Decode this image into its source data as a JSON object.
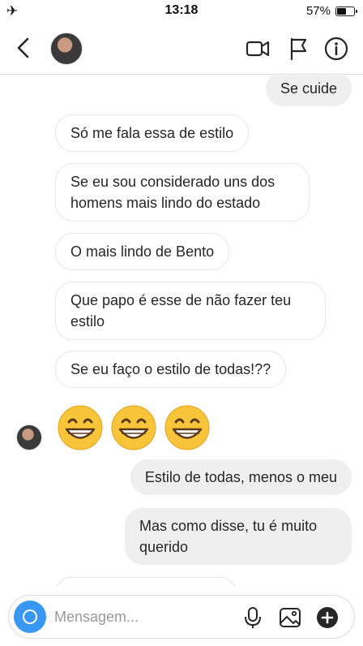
{
  "status_bar": {
    "time": "13:18",
    "battery": "57%",
    "battery_level": 0.57
  },
  "header": {
    "contact_name": ""
  },
  "messages": [
    {
      "dir": "out",
      "text": "Se cuide"
    },
    {
      "dir": "in",
      "text": "Só me fala essa de estilo"
    },
    {
      "dir": "in",
      "text": "Se eu sou considerado uns dos homens mais lindo do estado"
    },
    {
      "dir": "in",
      "text": "O mais lindo de Bento"
    },
    {
      "dir": "in",
      "text": "Que papo é esse de não fazer teu estilo"
    },
    {
      "dir": "in",
      "text": "Se eu faço o estilo de todas!??"
    },
    {
      "dir": "in",
      "text": "😁😁😁",
      "kind": "emoji"
    },
    {
      "dir": "out",
      "text": "Estilo de todas, menos o meu"
    },
    {
      "dir": "out",
      "text": "Mas como disse, tu é muito querido"
    }
  ],
  "composer": {
    "placeholder": "Mensagem..."
  },
  "icons": {
    "back": "chevron-left-icon",
    "video": "video-camera-icon",
    "flag": "flag-icon",
    "info": "info-icon",
    "camera": "camera-icon",
    "mic": "microphone-icon",
    "gallery": "image-icon",
    "add": "plus-circle-icon"
  },
  "colors": {
    "accent": "#3897f0",
    "incoming_bubble": "#ffffff",
    "outgoing_bubble": "#efefef"
  }
}
